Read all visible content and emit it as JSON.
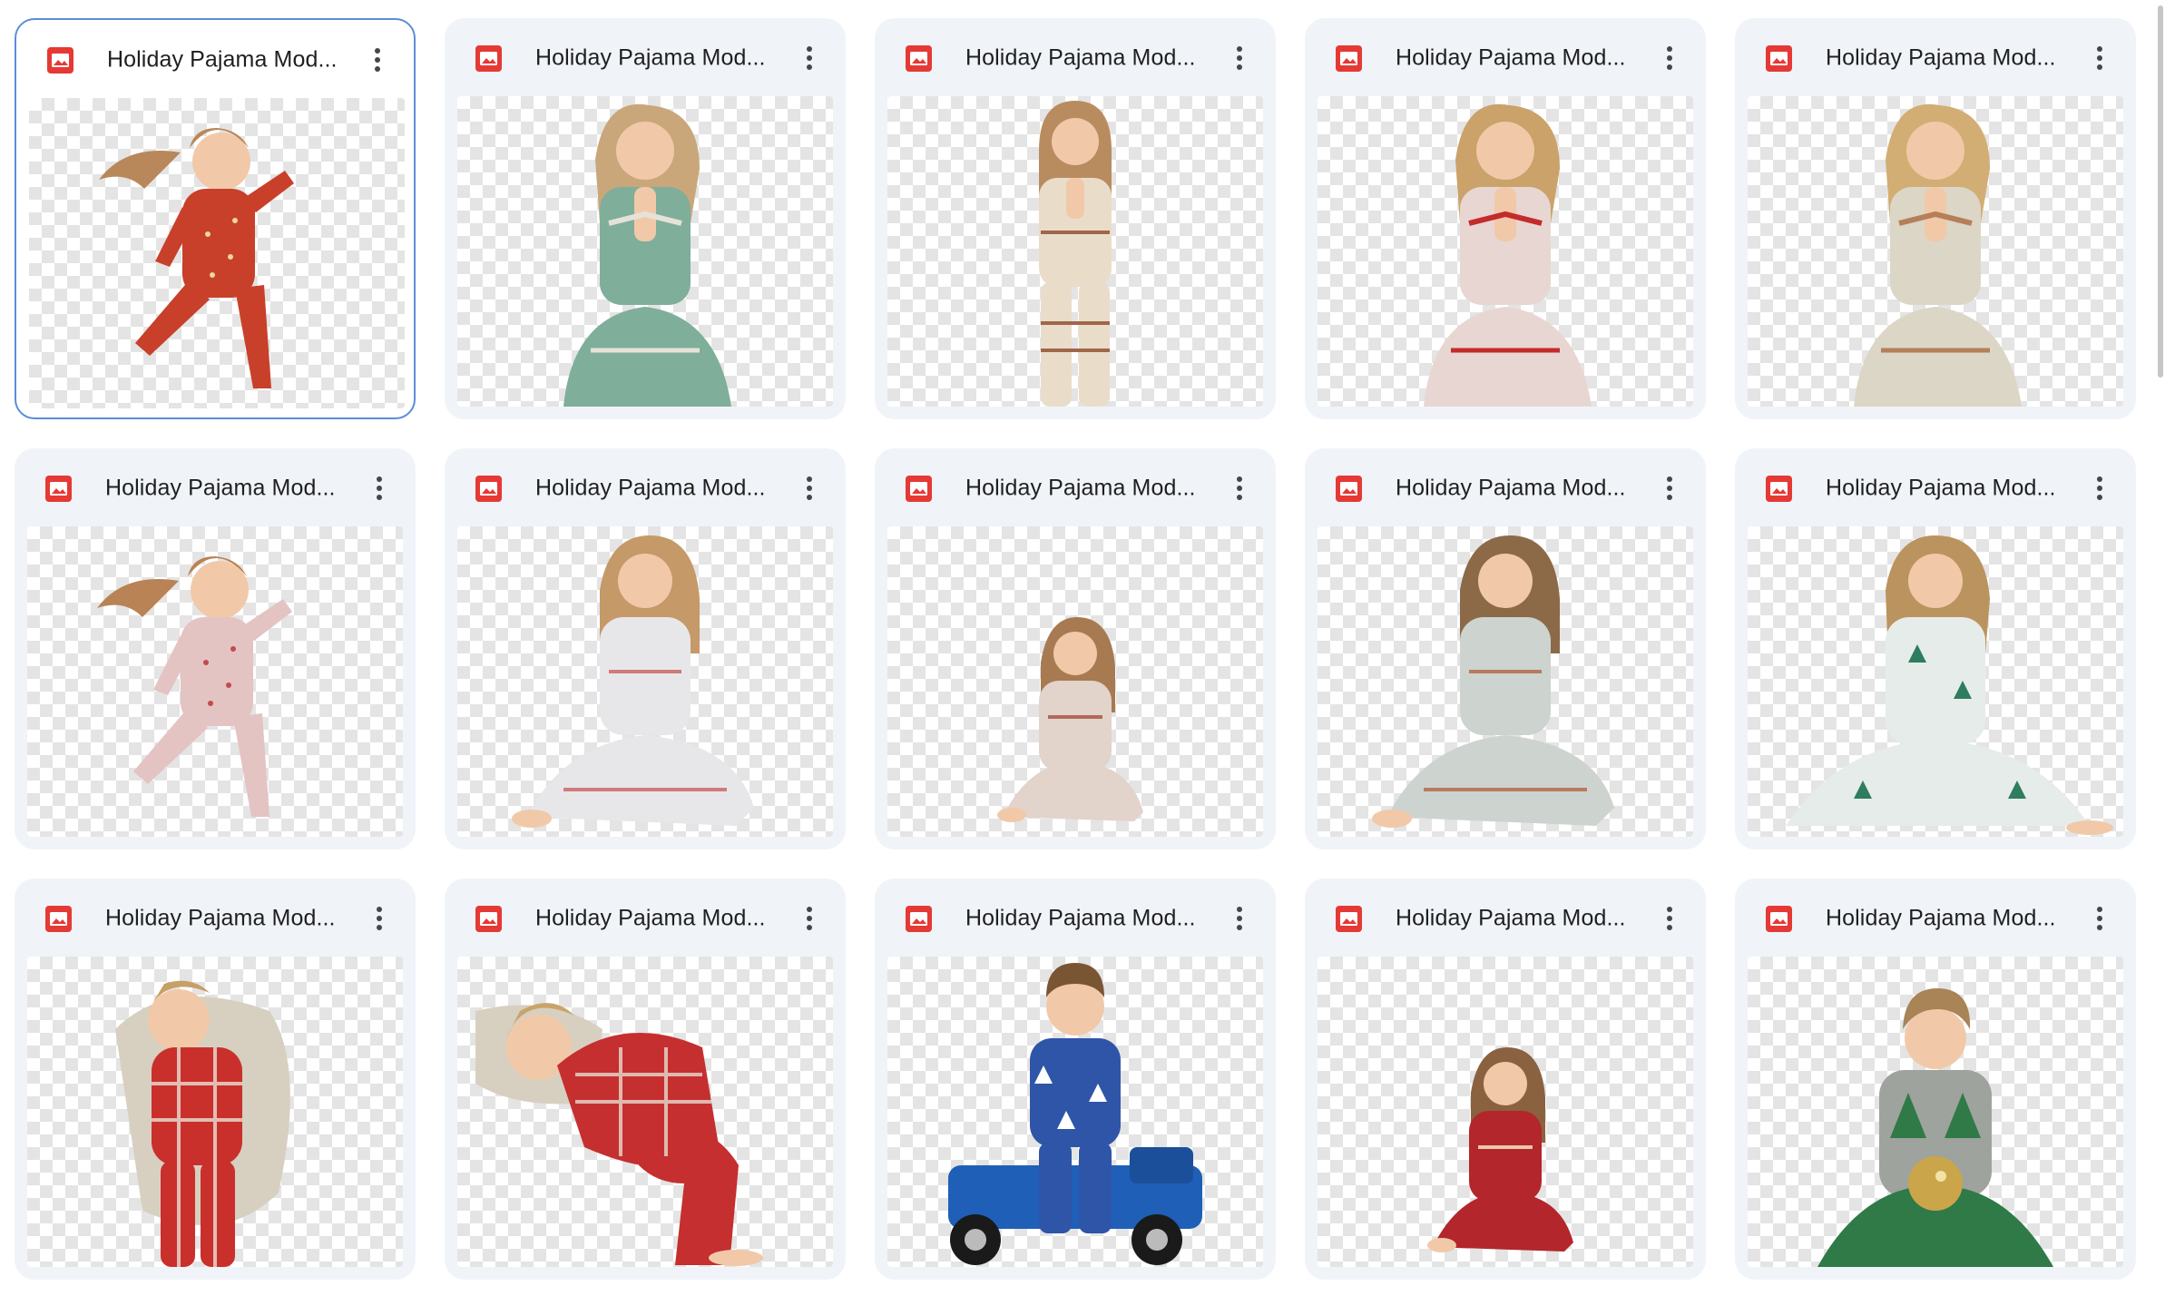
{
  "files": [
    {
      "name": "Holiday Pajama Mod...",
      "selected": true,
      "pajama": "#c8402a",
      "accent": "#f0d6a0",
      "hair": "#b8875a",
      "pose": "jump"
    },
    {
      "name": "Holiday Pajama Mod...",
      "selected": false,
      "pajama": "#7fae9a",
      "accent": "#e6e2d8",
      "hair": "#c9a77a",
      "pose": "kneel"
    },
    {
      "name": "Holiday Pajama Mod...",
      "selected": false,
      "pajama": "#e9ddca",
      "accent": "#a0664a",
      "hair": "#b98c60",
      "pose": "stand"
    },
    {
      "name": "Holiday Pajama Mod...",
      "selected": false,
      "pajama": "#e8d6d2",
      "accent": "#c42b2b",
      "hair": "#caa26a",
      "pose": "kneel"
    },
    {
      "name": "Holiday Pajama Mod...",
      "selected": false,
      "pajama": "#dcd6c6",
      "accent": "#b57f5a",
      "hair": "#d2ae74",
      "pose": "kneel"
    },
    {
      "name": "Holiday Pajama Mod...",
      "selected": false,
      "pajama": "#e4c3c3",
      "accent": "#c24b4b",
      "hair": "#b98356",
      "pose": "jump"
    },
    {
      "name": "Holiday Pajama Mod...",
      "selected": false,
      "pajama": "#e7e7ea",
      "accent": "#d07a7a",
      "hair": "#c59968",
      "pose": "sit"
    },
    {
      "name": "Holiday Pajama Mod...",
      "selected": false,
      "pajama": "#e2d3cb",
      "accent": "#b06a5a",
      "hair": "#a77a52",
      "pose": "sitsmall"
    },
    {
      "name": "Holiday Pajama Mod...",
      "selected": false,
      "pajama": "#cdd3cf",
      "accent": "#b87b5e",
      "hair": "#8c6a48",
      "pose": "sit"
    },
    {
      "name": "Holiday Pajama Mod...",
      "selected": false,
      "pajama": "#e6ecea",
      "accent": "#2e7d5e",
      "hair": "#bb935f",
      "pose": "sitwide"
    },
    {
      "name": "Holiday Pajama Mod...",
      "selected": false,
      "pajama": "#c9302c",
      "accent": "#e9e1d6",
      "hair": "#c7a065",
      "pose": "sleep"
    },
    {
      "name": "Holiday Pajama Mod...",
      "selected": false,
      "pajama": "#c52f2f",
      "accent": "#e6dccf",
      "hair": "#c9a46a",
      "pose": "sleepside"
    },
    {
      "name": "Holiday Pajama Mod...",
      "selected": false,
      "pajama": "#2f55a8",
      "accent": "#ffffff",
      "hair": "#7a5534",
      "pose": "truck"
    },
    {
      "name": "Holiday Pajama Mod...",
      "selected": false,
      "pajama": "#b3262b",
      "accent": "#e8c9a8",
      "hair": "#8a6240",
      "pose": "sitsmall"
    },
    {
      "name": "Holiday Pajama Mod...",
      "selected": false,
      "pajama": "#9ea39d",
      "accent": "#2f7a47",
      "hair": "#a88456",
      "pose": "ornament"
    }
  ],
  "icon": "image-file-icon",
  "more_icon": "more-vert-icon"
}
